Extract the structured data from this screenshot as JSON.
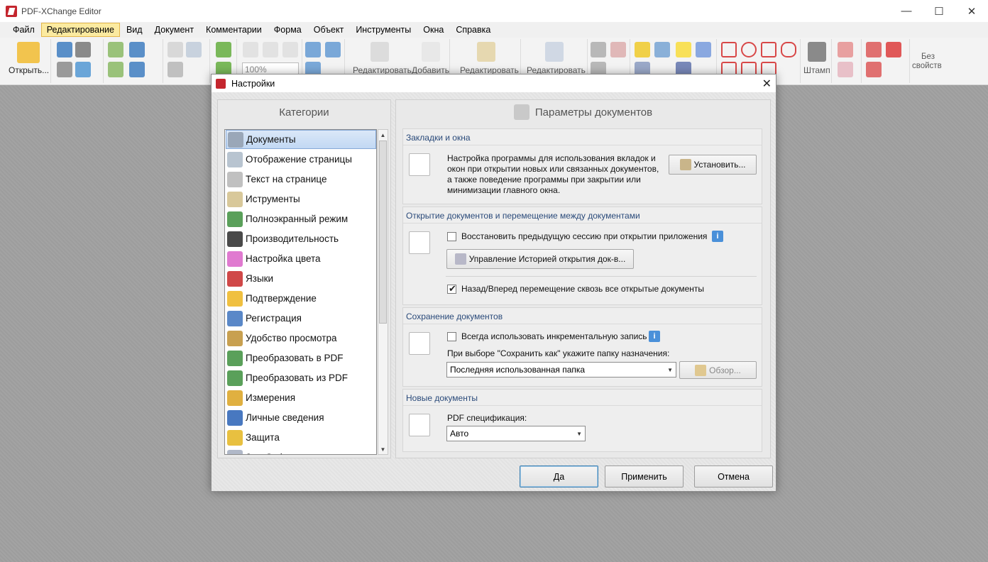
{
  "app": {
    "title": "PDF-XChange Editor",
    "minimize": "—",
    "maximize": "☐",
    "close": "✕"
  },
  "menu": [
    "Файл",
    "Редактирование",
    "Вид",
    "Документ",
    "Комментарии",
    "Форма",
    "Объект",
    "Инструменты",
    "Окна",
    "Справка"
  ],
  "menu_active": "Редактирование",
  "ribbon": {
    "open_label": "Открыть...",
    "zoom_value": "100%",
    "edit_text_label": "Редактировать",
    "add_label": "Добавить",
    "edit2_label": "Редактировать",
    "edit3_label": "Редактировать",
    "stamp_label": "Штамп",
    "no_props_line1": "Без",
    "no_props_line2": "свойств"
  },
  "dialog": {
    "title": "Настройки",
    "close": "✕",
    "categories_header": "Категории",
    "params_header": "Параметры документов",
    "categories": [
      {
        "label": "Документы",
        "icon": "documents-icon",
        "color": "#9aa7b8"
      },
      {
        "label": "Отображение страницы",
        "icon": "page-view-icon",
        "color": "#b8c4d0"
      },
      {
        "label": "Текст на странице",
        "icon": "page-text-icon",
        "color": "#c0c0c0"
      },
      {
        "label": "Иструменты",
        "icon": "tools-icon",
        "color": "#d8c89a"
      },
      {
        "label": "Полноэкранный режим",
        "icon": "fullscreen-icon",
        "color": "#5aa05a"
      },
      {
        "label": "Производительность",
        "icon": "performance-icon",
        "color": "#4a4a4a"
      },
      {
        "label": "Настройка цвета",
        "icon": "color-wheel-icon",
        "color": "#e07ad0"
      },
      {
        "label": "Языки",
        "icon": "languages-icon",
        "color": "#d04848"
      },
      {
        "label": "Подтверждение",
        "icon": "question-icon",
        "color": "#f0c040"
      },
      {
        "label": "Регистрация",
        "icon": "user-key-icon",
        "color": "#5a88c8"
      },
      {
        "label": "Удобство просмотра",
        "icon": "glasses-icon",
        "color": "#c8a050"
      },
      {
        "label": "Преобразовать в PDF",
        "icon": "convert-to-pdf-icon",
        "color": "#5aa05a"
      },
      {
        "label": "Преобразовать из PDF",
        "icon": "convert-from-pdf-icon",
        "color": "#5aa05a"
      },
      {
        "label": "Измерения",
        "icon": "ruler-icon",
        "color": "#e0b040"
      },
      {
        "label": "Личные сведения",
        "icon": "person-icon",
        "color": "#4878c0"
      },
      {
        "label": "Защита",
        "icon": "shield-icon",
        "color": "#e8c040"
      },
      {
        "label": "JavaScript",
        "icon": "javascript-icon",
        "color": "#b0b8c8"
      }
    ],
    "selected_index": 0,
    "sections": {
      "bookmarks": {
        "title": "Закладки и окна",
        "description": [
          "Настройка программы для использования вкладок и",
          "окон при открытии новых или связанных документов,",
          "а также поведение программы при закрытии или",
          "минимизации главного окна."
        ],
        "setup_button": "Установить..."
      },
      "opening": {
        "title": "Открытие документов и перемещение между документами",
        "restore_session_label": "Восстановить предыдущую сессию при открытии приложения",
        "restore_session_checked": false,
        "history_button": "Управление Историей открытия док-в...",
        "back_forward_label": "Назад/Вперед перемещение сквозь все открытые документы",
        "back_forward_checked": true,
        "info": "i"
      },
      "saving": {
        "title": "Сохранение документов",
        "incremental_label": "Всегда использовать инкрементальную запись",
        "incremental_checked": false,
        "save_as_label": "При выборе \"Сохранить как\" укажите папку назначения:",
        "folder_value": "Последняя использованная папка",
        "browse_button": "Обзор...",
        "info": "i"
      },
      "new_docs": {
        "title": "Новые документы",
        "pdf_spec_label": "PDF спецификация:",
        "pdf_spec_value": "Авто"
      }
    },
    "buttons": {
      "ok": "Да",
      "apply": "Применить",
      "cancel": "Отмена"
    }
  },
  "colors": {
    "menu_active_bg": "#fbeaa0",
    "selection": "#c2d8f3",
    "brand": "#c4262e",
    "info": "#4a90d9"
  }
}
